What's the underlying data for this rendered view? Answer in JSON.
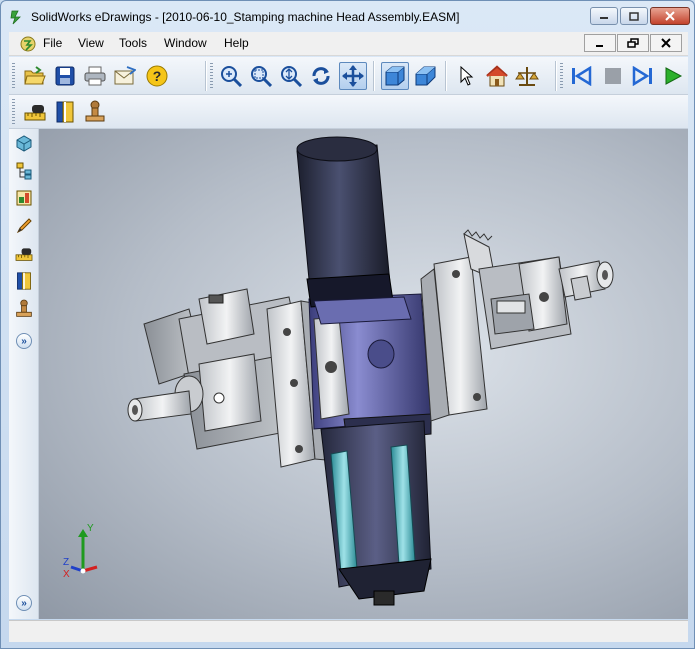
{
  "window": {
    "title": "SolidWorks eDrawings - [2010-06-10_Stamping machine Head Assembly.EASM]"
  },
  "menu": {
    "items": [
      "File",
      "View",
      "Tools",
      "Window",
      "Help"
    ]
  },
  "toolbar": {
    "icons": [
      "open-icon",
      "save-icon",
      "print-icon",
      "send-mail-icon",
      "help-icon",
      "zoom-to-fit-icon",
      "zoom-to-area-icon",
      "zoom-icon",
      "rotate-icon",
      "pan-icon",
      "shaded-icon",
      "perspective-icon",
      "select-icon",
      "home-icon",
      "3d-pointer-icon",
      "first-frame-icon",
      "stop-icon",
      "next-frame-icon",
      "play-icon"
    ],
    "row2_icons": [
      "measure-icon",
      "section-icon",
      "stamp-icon"
    ]
  },
  "left_toolbar": {
    "icons": [
      "components-icon",
      "tree-icon",
      "sheets-icon",
      "markup-icon",
      "measure-icon",
      "section-icon",
      "stamp-icon"
    ]
  },
  "triad": {
    "x_label": "X",
    "y_label": "Y",
    "z_label": "Z"
  },
  "colors": {
    "accent": "#1b4f9c",
    "cylinder": "#3a3f55",
    "body": "#5b5ea6",
    "glass": "#6fc2c8"
  }
}
